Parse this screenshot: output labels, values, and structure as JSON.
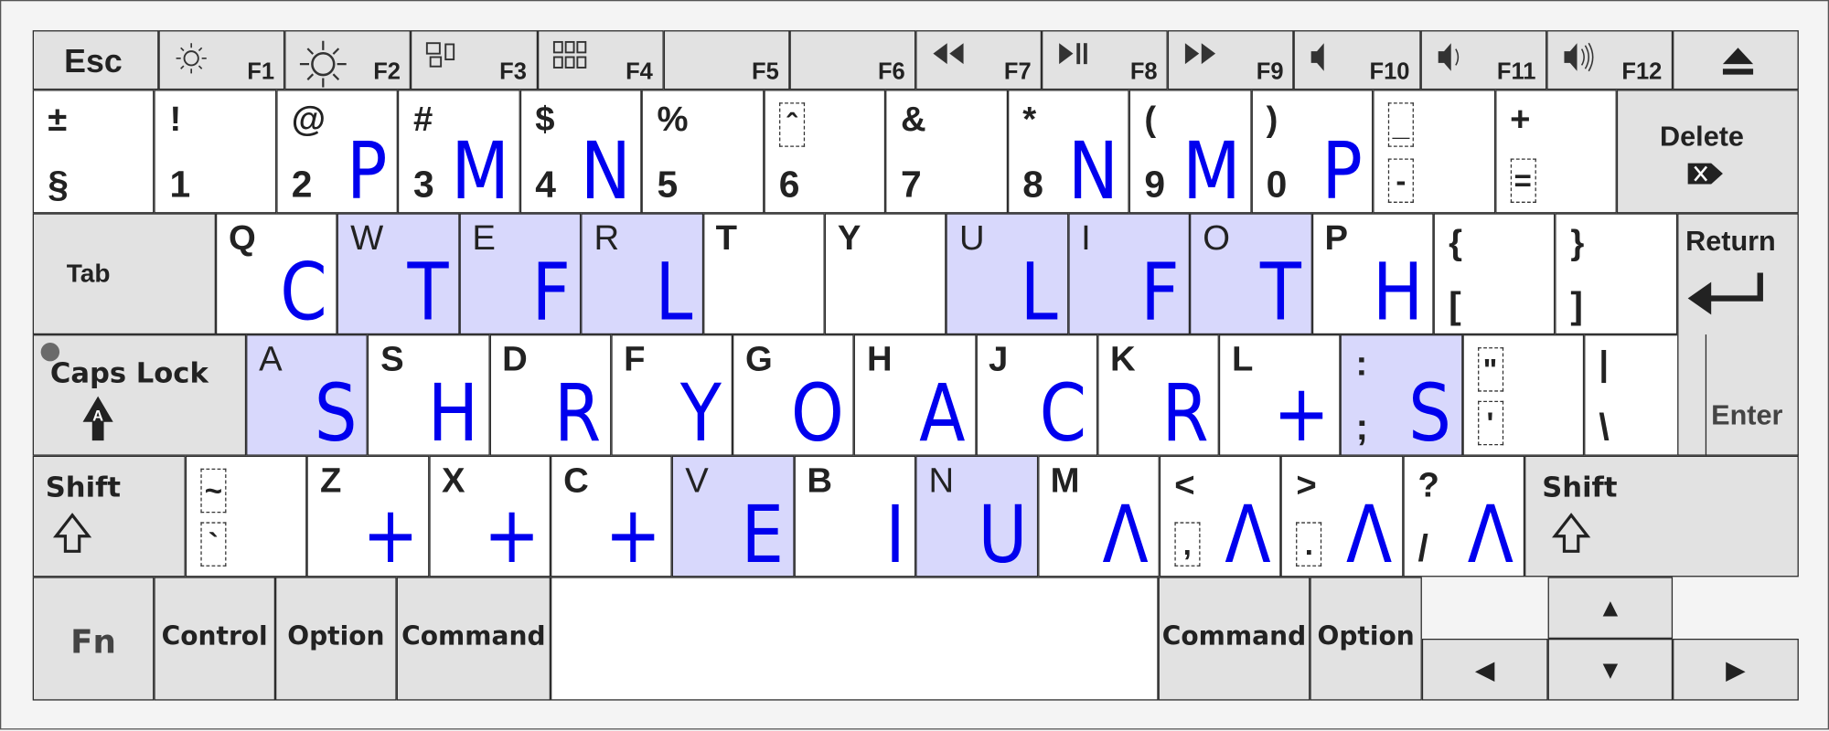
{
  "colors": {
    "highlight": "#d8d8fc",
    "blue_label": "#0000ee",
    "modifier": "#e2e2e2",
    "border": "#2a2a2a"
  },
  "rows": [
    [
      {
        "label": "Esc",
        "type": "esc"
      },
      {
        "label": "F1",
        "icon": "brightness-down-icon",
        "type": "f"
      },
      {
        "label": "F2",
        "icon": "brightness-up-icon",
        "type": "f"
      },
      {
        "label": "F3",
        "icon": "mission-control-icon",
        "type": "f"
      },
      {
        "label": "F4",
        "icon": "launchpad-icon",
        "type": "f"
      },
      {
        "label": "F5",
        "type": "f"
      },
      {
        "label": "F6",
        "type": "f"
      },
      {
        "label": "F7",
        "icon": "rewind-icon",
        "type": "f"
      },
      {
        "label": "F8",
        "icon": "play-pause-icon",
        "type": "f"
      },
      {
        "label": "F9",
        "icon": "fast-forward-icon",
        "type": "f"
      },
      {
        "label": "F10",
        "icon": "mute-icon",
        "type": "f"
      },
      {
        "label": "F11",
        "icon": "volume-down-icon",
        "type": "f"
      },
      {
        "label": "F12",
        "icon": "volume-up-icon",
        "type": "f"
      },
      {
        "icon": "eject-icon",
        "type": "eject"
      }
    ],
    [
      {
        "top": "±",
        "bottom": "§"
      },
      {
        "top": "!",
        "bottom": "1"
      },
      {
        "top": "@",
        "bottom": "2",
        "blue": "P"
      },
      {
        "top": "#",
        "bottom": "3",
        "blue": "M"
      },
      {
        "top": "$",
        "bottom": "4",
        "blue": "N"
      },
      {
        "top": "%",
        "bottom": "5"
      },
      {
        "top": "ˆ",
        "bottom": "6",
        "dash_top": true
      },
      {
        "top": "&",
        "bottom": "7"
      },
      {
        "top": "*",
        "bottom": "8",
        "blue": "N"
      },
      {
        "top": "(",
        "bottom": "9",
        "blue": "M"
      },
      {
        "top": ")",
        "bottom": "0",
        "blue": "P"
      },
      {
        "top": "_",
        "bottom": "-",
        "dash_top": true,
        "dash_bottom": true
      },
      {
        "top": "+",
        "bottom": "=",
        "dash_bottom": true
      },
      {
        "label": "Delete",
        "icon": "delete-icon",
        "type": "delete"
      }
    ],
    [
      {
        "label": "Tab",
        "type": "tab"
      },
      {
        "letter": "Q",
        "blue": "C"
      },
      {
        "letter": "W",
        "blue": "T",
        "hl": true
      },
      {
        "letter": "E",
        "blue": "F",
        "hl": true
      },
      {
        "letter": "R",
        "blue": "L",
        "hl": true
      },
      {
        "letter": "T"
      },
      {
        "letter": "Y"
      },
      {
        "letter": "U",
        "blue": "L",
        "hl": true
      },
      {
        "letter": "I",
        "blue": "F",
        "hl": true
      },
      {
        "letter": "O",
        "blue": "T",
        "hl": true
      },
      {
        "letter": "P",
        "blue": "H"
      },
      {
        "top": "{",
        "bottom": "["
      },
      {
        "top": "}",
        "bottom": "]"
      },
      {
        "label": "Return",
        "icon": "return-icon",
        "type": "return"
      }
    ],
    [
      {
        "label": "Caps Lock",
        "icon": "caps-lock-icon",
        "type": "caps"
      },
      {
        "letter": "A",
        "blue": "S",
        "hl": true
      },
      {
        "letter": "S",
        "blue": "H"
      },
      {
        "letter": "D",
        "blue": "R"
      },
      {
        "letter": "F",
        "blue": "Y"
      },
      {
        "letter": "G",
        "blue": "O"
      },
      {
        "letter": "H",
        "blue": "A"
      },
      {
        "letter": "J",
        "blue": "C"
      },
      {
        "letter": "K",
        "blue": "R"
      },
      {
        "letter": "L",
        "blue": "+"
      },
      {
        "top": ":",
        "bottom": ";",
        "blue": "S",
        "hl": true
      },
      {
        "top": "\"",
        "bottom": "'",
        "dash_top": true,
        "dash_bottom": true
      },
      {
        "top": "|",
        "bottom": "\\"
      },
      {
        "label": "Enter",
        "type": "enter"
      }
    ],
    [
      {
        "label": "Shift",
        "icon": "shift-icon",
        "type": "shift"
      },
      {
        "top": "~",
        "bottom": "`",
        "dash_top": true,
        "dash_bottom": true
      },
      {
        "letter": "Z",
        "blue": "+"
      },
      {
        "letter": "X",
        "blue": "+"
      },
      {
        "letter": "C",
        "blue": "+"
      },
      {
        "letter": "V",
        "blue": "E",
        "hl": true
      },
      {
        "letter": "B",
        "blue": "I"
      },
      {
        "letter": "N",
        "blue": "U",
        "hl": true
      },
      {
        "letter": "M",
        "blue": "Λ"
      },
      {
        "top": "<",
        "bottom": ",",
        "blue": "Λ",
        "dash_bottom": true
      },
      {
        "top": ">",
        "bottom": ".",
        "blue": "Λ",
        "dash_bottom": true
      },
      {
        "top": "?",
        "bottom": "/",
        "blue": "Λ"
      },
      {
        "label": "Shift",
        "icon": "shift-icon",
        "type": "shift"
      }
    ],
    [
      {
        "label": "Fn",
        "type": "mod"
      },
      {
        "label": "Control",
        "type": "mod"
      },
      {
        "label": "Option",
        "type": "mod"
      },
      {
        "label": "Command",
        "type": "mod"
      },
      {
        "label": "",
        "type": "space"
      },
      {
        "label": "Command",
        "type": "mod"
      },
      {
        "label": "Option",
        "type": "mod"
      },
      {
        "label": "▲",
        "icon": "arrow-up-icon",
        "type": "arrow"
      },
      {
        "label": "◀",
        "icon": "arrow-left-icon",
        "type": "arrow"
      },
      {
        "label": "▼",
        "icon": "arrow-down-icon",
        "type": "arrow"
      },
      {
        "label": "▶",
        "icon": "arrow-right-icon",
        "type": "arrow"
      }
    ]
  ]
}
